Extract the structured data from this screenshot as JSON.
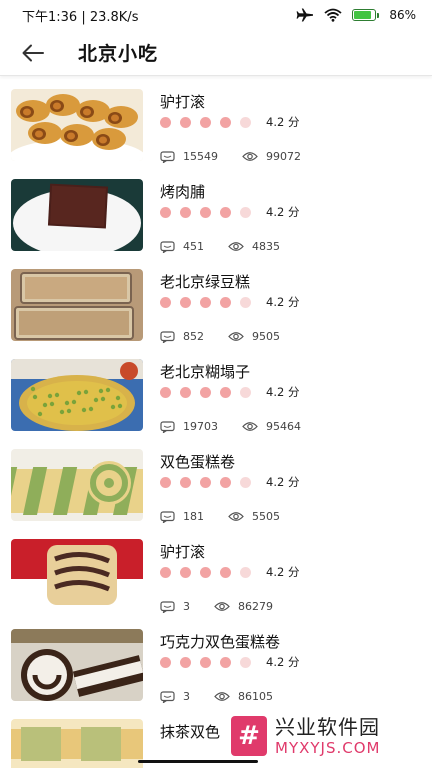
{
  "status_bar": {
    "time_speed": "下午1:36 | 23.8K/s",
    "battery_text": "86%",
    "battery_level": 0.86,
    "icons": [
      "airplane-icon",
      "wifi-icon",
      "battery-icon"
    ]
  },
  "app_bar": {
    "title": "北京小吃",
    "back_icon": "arrow-left-icon"
  },
  "items": [
    {
      "title": "驴打滚",
      "score": "4.2 分",
      "rating": 4,
      "comments": "15549",
      "views": "99072",
      "thumb": "rolls"
    },
    {
      "title": "烤肉脯",
      "score": "4.2 分",
      "rating": 4,
      "comments": "451",
      "views": "4835",
      "thumb": "jerky"
    },
    {
      "title": "老北京绿豆糕",
      "score": "4.2 分",
      "rating": 4,
      "comments": "852",
      "views": "9505",
      "thumb": "tray"
    },
    {
      "title": "老北京糊塌子",
      "score": "4.2 分",
      "rating": 4,
      "comments": "19703",
      "views": "95464",
      "thumb": "pancake"
    },
    {
      "title": "双色蛋糕卷",
      "score": "4.2 分",
      "rating": 4,
      "comments": "181",
      "views": "5505",
      "thumb": "greenroll"
    },
    {
      "title": "驴打滚",
      "score": "4.2 分",
      "rating": 4,
      "comments": "3",
      "views": "86279",
      "thumb": "redroll"
    },
    {
      "title": "巧克力双色蛋糕卷",
      "score": "4.2 分",
      "rating": 4,
      "comments": "3",
      "views": "86105",
      "thumb": "chocroll"
    },
    {
      "title": "抹茶双色",
      "score": "",
      "rating": 0,
      "comments": "",
      "views": "",
      "thumb": "matcha"
    }
  ],
  "watermark": {
    "logo_glyph": "#",
    "name": "兴业软件园",
    "url": "MYXYJS.COM"
  },
  "colors": {
    "rating_dot": "#f2a3a3",
    "rating_dot_empty": "#f7d9d9",
    "watermark_accent": "#e03a6b"
  }
}
